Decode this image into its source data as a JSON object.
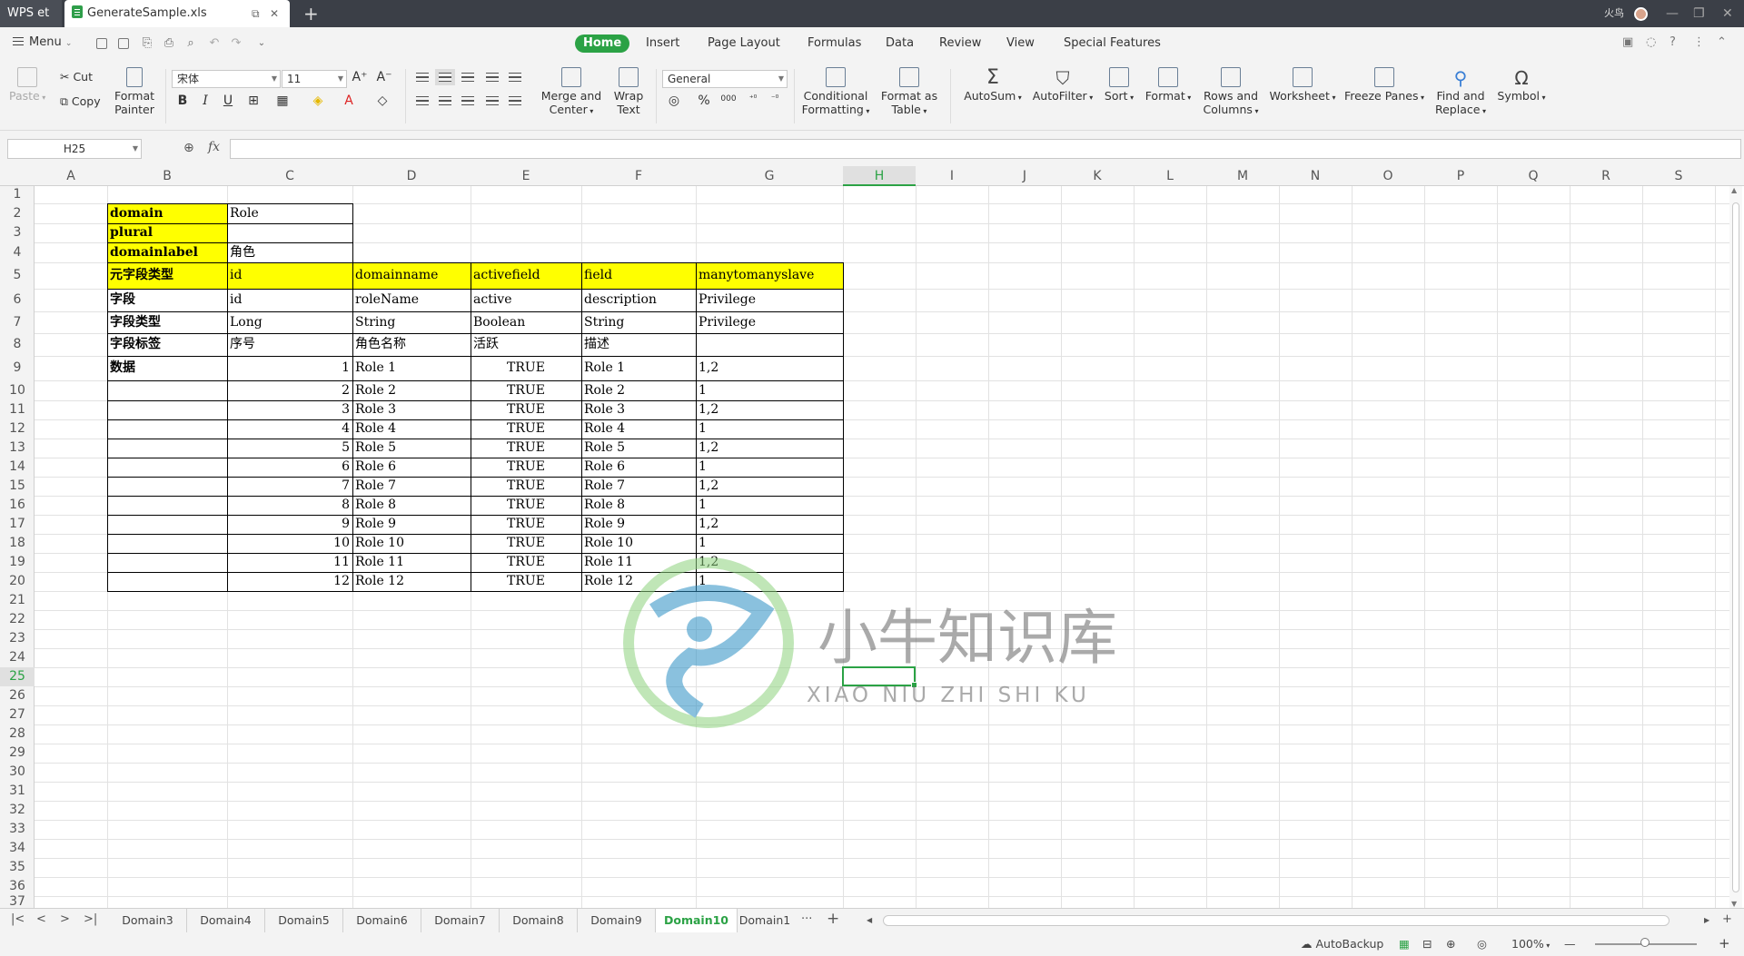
{
  "titlebar": {
    "app_name": "WPS et",
    "doc_name": "GenerateSample.xls",
    "user_name": "火鸟"
  },
  "menu": {
    "menu_label": "Menu",
    "tabs": [
      "Home",
      "Insert",
      "Page Layout",
      "Formulas",
      "Data",
      "Review",
      "View",
      "Special Features"
    ],
    "active_tab": "Home"
  },
  "ribbon": {
    "paste": "Paste",
    "cut": "Cut",
    "copy": "Copy",
    "format_painter_1": "Format",
    "format_painter_2": "Painter",
    "font_name": "宋体",
    "font_size": "11",
    "merge_1": "Merge and",
    "merge_2": "Center",
    "wrap_1": "Wrap",
    "wrap_2": "Text",
    "number_format": "General",
    "cond_1": "Conditional",
    "cond_2": "Formatting",
    "fmt_table_1": "Format as",
    "fmt_table_2": "Table",
    "autosum": "AutoSum",
    "autofilter": "AutoFilter",
    "sort": "Sort",
    "format": "Format",
    "rows_cols_1": "Rows and",
    "rows_cols_2": "Columns",
    "worksheet": "Worksheet",
    "freeze": "Freeze Panes",
    "find_1": "Find and",
    "find_2": "Replace",
    "symbol": "Symbol",
    "bold": "B",
    "italic": "I",
    "underline": "U",
    "percent": "%",
    "thousands": "000"
  },
  "formula_bar": {
    "name_box": "H25",
    "fx": "fx",
    "formula": ""
  },
  "columns": [
    "A",
    "B",
    "C",
    "D",
    "E",
    "F",
    "G",
    "H",
    "I",
    "J",
    "K",
    "L",
    "M",
    "N",
    "O",
    "P",
    "Q",
    "R",
    "S"
  ],
  "selected_column": "H",
  "rows": [
    "1",
    "2",
    "3",
    "4",
    "5",
    "6",
    "7",
    "8",
    "9",
    "10",
    "11",
    "12",
    "13",
    "14",
    "15",
    "16",
    "17",
    "18",
    "19",
    "20",
    "21",
    "22",
    "23",
    "24",
    "25",
    "26",
    "27",
    "28",
    "29",
    "30",
    "31",
    "32",
    "33",
    "34",
    "35",
    "36",
    "37"
  ],
  "selected_row": "25",
  "cells": {
    "meta": [
      {
        "label": "domain",
        "value": "Role"
      },
      {
        "label": "plural",
        "value": ""
      },
      {
        "label": "domainlabel",
        "value": "角色"
      }
    ],
    "header_row": [
      "元字段类型",
      "id",
      "domainname",
      "activefield",
      "field",
      "manytomanyslave"
    ],
    "field_row": [
      "字段",
      "id",
      "roleName",
      "active",
      "description",
      "Privilege"
    ],
    "type_row": [
      "字段类型",
      "Long",
      "String",
      "Boolean",
      "String",
      "Privilege"
    ],
    "label_row": [
      "字段标签",
      "序号",
      "角色名称",
      "活跃",
      "描述",
      ""
    ],
    "data_label": "数据",
    "data": [
      [
        "1",
        "Role 1",
        "TRUE",
        "Role 1",
        "1,2"
      ],
      [
        "2",
        "Role 2",
        "TRUE",
        "Role 2",
        "1"
      ],
      [
        "3",
        "Role 3",
        "TRUE",
        "Role 3",
        "1,2"
      ],
      [
        "4",
        "Role 4",
        "TRUE",
        "Role 4",
        "1"
      ],
      [
        "5",
        "Role 5",
        "TRUE",
        "Role 5",
        "1,2"
      ],
      [
        "6",
        "Role 6",
        "TRUE",
        "Role 6",
        "1"
      ],
      [
        "7",
        "Role 7",
        "TRUE",
        "Role 7",
        "1,2"
      ],
      [
        "8",
        "Role 8",
        "TRUE",
        "Role 8",
        "1"
      ],
      [
        "9",
        "Role 9",
        "TRUE",
        "Role 9",
        "1,2"
      ],
      [
        "10",
        "Role 10",
        "TRUE",
        "Role 10",
        "1"
      ],
      [
        "11",
        "Role 11",
        "TRUE",
        "Role 11",
        "1,2"
      ],
      [
        "12",
        "Role 12",
        "TRUE",
        "Role 12",
        "1"
      ]
    ]
  },
  "watermark": {
    "title": "小牛知识库",
    "subtitle": "XIAO NIU ZHI SHI KU"
  },
  "sheet_tabs": [
    "Domain3",
    "Domain4",
    "Domain5",
    "Domain6",
    "Domain7",
    "Domain8",
    "Domain9",
    "Domain10",
    "Domain1"
  ],
  "active_sheet": "Domain10",
  "more_tabs": "···",
  "add_tab": "+",
  "statusbar": {
    "autobackup": "AutoBackup",
    "zoom": "100%"
  },
  "colors": {
    "accent": "#2ba245",
    "header_fill": "#ffff00",
    "titlebar": "#3b3f47"
  }
}
